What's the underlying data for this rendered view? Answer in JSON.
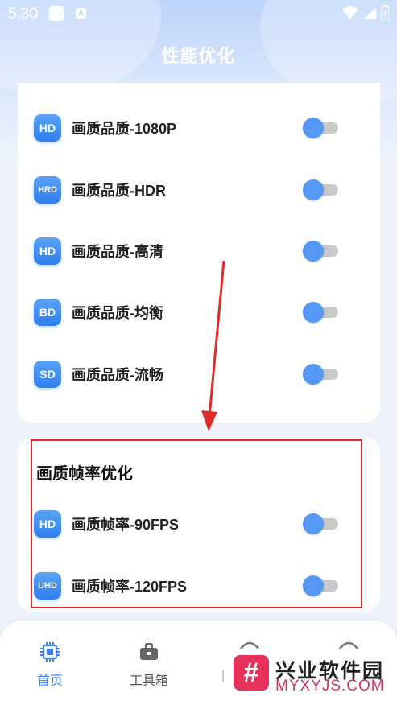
{
  "status_bar": {
    "time": "5:30",
    "notif_letter": "A"
  },
  "header": {
    "title": "性能优化"
  },
  "quality_list": [
    {
      "badge": "HD",
      "label": "画质品质-1080P"
    },
    {
      "badge": "HRD",
      "label": "画质品质-HDR"
    },
    {
      "badge": "HD",
      "label": "画质品质-高清"
    },
    {
      "badge": "BD",
      "label": "画质品质-均衡"
    },
    {
      "badge": "SD",
      "label": "画质品质-流畅"
    }
  ],
  "frame_section": {
    "title": "画质帧率优化",
    "items": [
      {
        "badge": "HD",
        "label": "画质帧率-90FPS"
      },
      {
        "badge": "UHD",
        "label": "画质帧率-120FPS"
      }
    ]
  },
  "bottom_nav": {
    "items": [
      {
        "label": "首页",
        "icon": "chip-icon",
        "active": true
      },
      {
        "label": "工具箱",
        "icon": "toolbox-icon",
        "active": false
      }
    ]
  },
  "watermark": {
    "logo": "#",
    "name": "兴业软件园",
    "url": "MYXYJS.COM"
  },
  "colors": {
    "accent": "#3b82f6",
    "badge": "#3f8df2",
    "highlight": "#e02a2a",
    "toggle_knob": "#5699f5"
  }
}
